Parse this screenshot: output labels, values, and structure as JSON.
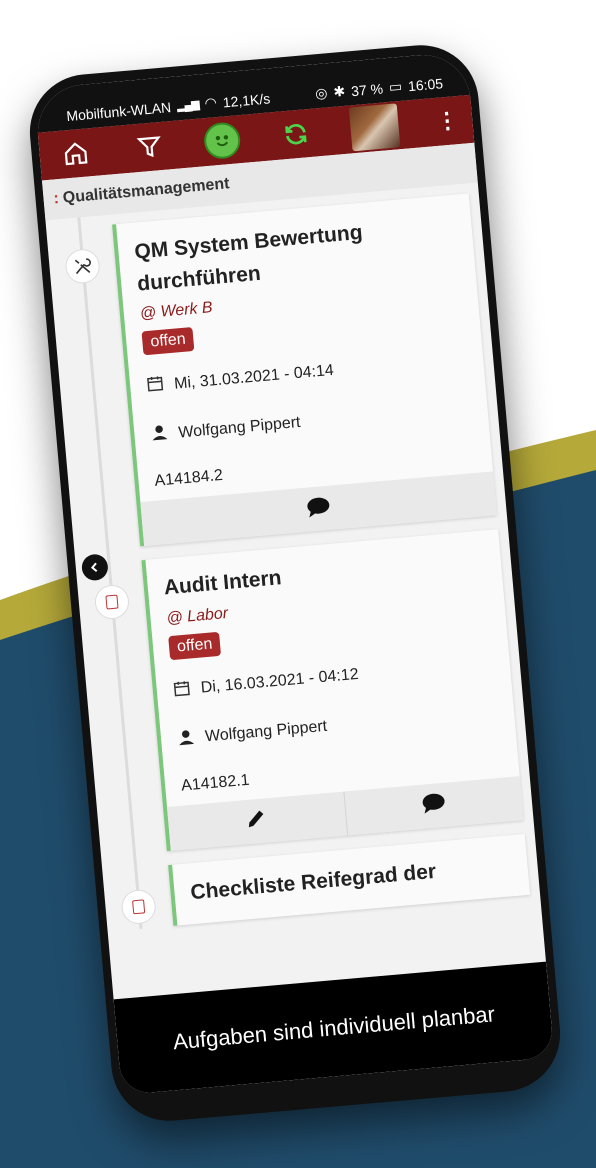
{
  "status_bar": {
    "carrier": "Mobilfunk-WLAN",
    "speed": "12,1K/s",
    "battery": "37 %",
    "time": "16:05"
  },
  "colors": {
    "topbar": "#7b1616",
    "badge": "#a92a2a",
    "accent_green": "#7cc77c",
    "location": "#8b1a1a"
  },
  "topbar": {
    "icons": [
      "home-icon",
      "filter-icon",
      "smiley-icon",
      "refresh-icon",
      "avatar",
      "more-icon"
    ]
  },
  "breadcrumb": {
    "prefix": ":",
    "label": "Qualitätsmanagement"
  },
  "tasks": [
    {
      "title": "QM System Bewertung durchführen",
      "location": "@ Werk B",
      "status": "offen",
      "datetime": "Mi, 31.03.2021 - 04:14",
      "person": "Wolfgang Pippert",
      "ref": "A14184.2",
      "node_icon": "tools-icon",
      "actions": [
        "comment-icon"
      ]
    },
    {
      "title": "Audit Intern",
      "location": "@ Labor",
      "status": "offen",
      "datetime": "Di, 16.03.2021 - 04:12",
      "person": "Wolfgang Pippert",
      "ref": "A14182.1",
      "node_icon": "checklist-icon",
      "actions": [
        "edit-icon",
        "comment-icon"
      ]
    },
    {
      "title": "Checkliste Reifegrad der",
      "node_icon": "checklist-icon"
    }
  ],
  "banner": {
    "text": "Aufgaben sind individuell planbar"
  }
}
